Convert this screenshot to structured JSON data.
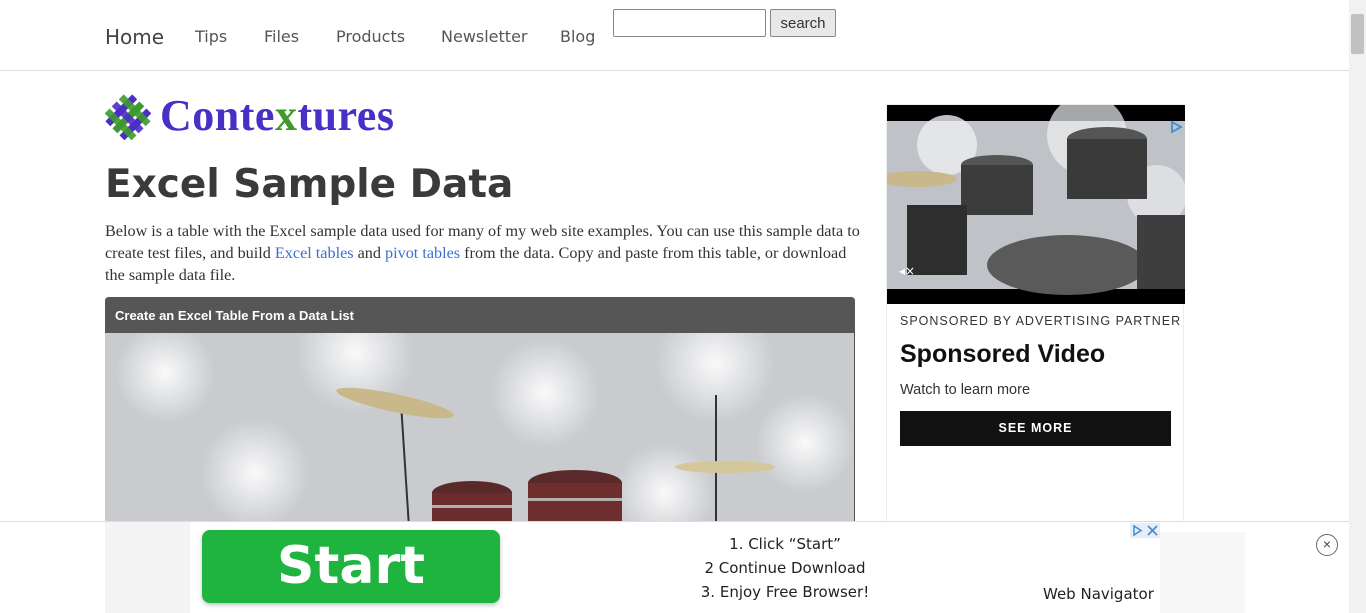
{
  "nav": {
    "home": "Home",
    "items": [
      "Tips",
      "Files",
      "Products",
      "Newsletter",
      "Blog"
    ],
    "search_button": "search",
    "search_value": ""
  },
  "logo": {
    "text_pre": "Conte",
    "text_x": "x",
    "text_post": "tures"
  },
  "page": {
    "title": "Excel Sample Data",
    "intro_part1": "Below is a table with the Excel sample data used for many of my web site examples. You can use this sample data to create test files, and build ",
    "link1": "Excel tables",
    "intro_part2": " and ",
    "link2": "pivot tables",
    "intro_part3": " from the data. Copy and paste from this table, or download the sample data file."
  },
  "video": {
    "header": "Create an Excel Table From a Data List"
  },
  "sidebar_ad": {
    "sponsor": "SPONSORED BY ADVERTISING PARTNER",
    "title": "Sponsored Video",
    "subtitle": "Watch to learn more",
    "button": "SEE MORE"
  },
  "bottom_ad": {
    "button": "Start",
    "steps": [
      "1. Click “Start”",
      "2 Continue Download",
      "3. Enjoy Free Browser!"
    ],
    "brand": "Web Navigator",
    "close": "×"
  },
  "colors": {
    "link": "#3b6fd6",
    "logo_purple": "#4a2fc7",
    "logo_green": "#3e9a2f",
    "start_green": "#1fb340"
  }
}
